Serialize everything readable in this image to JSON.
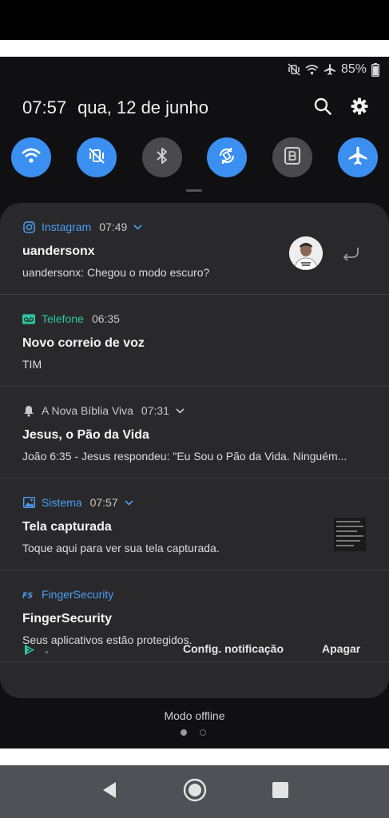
{
  "status_bar": {
    "battery_text": "85%",
    "icons": [
      "mute-vibrate-icon",
      "wifi-icon",
      "airplane-icon",
      "battery-icon"
    ]
  },
  "header": {
    "time": "07:57",
    "date": "qua, 12 de junho",
    "icons": [
      "search-icon",
      "gear-icon"
    ]
  },
  "quick_settings": [
    {
      "name": "wifi",
      "state": "on"
    },
    {
      "name": "mute",
      "state": "on"
    },
    {
      "name": "bluetooth",
      "state": "off"
    },
    {
      "name": "auto-rotate",
      "state": "on"
    },
    {
      "name": "blue-light-filter",
      "state": "off"
    },
    {
      "name": "airplane-mode",
      "state": "on"
    }
  ],
  "notifications": [
    {
      "app": "Instagram",
      "time": "07:49",
      "title": "uandersonx",
      "text": "uandersonx: Chegou o modo escuro?",
      "app_color": "#4a9ff5",
      "expandable": true
    },
    {
      "app": "Telefone",
      "time": "06:35",
      "title": "Novo correio de voz",
      "text": "TIM",
      "app_color": "#2ec4a5",
      "expandable": false
    },
    {
      "app": "A Nova Bíblia Viva",
      "time": "07:31",
      "title": "Jesus, o Pão da Vida",
      "text": "João 6:35 - Jesus respondeu: \"Eu Sou o Pão da Vida. Ninguém...",
      "app_color": "#c8c8c8",
      "expandable": true
    },
    {
      "app": "Sistema",
      "time": "07:57",
      "title": "Tela capturada",
      "text": "Toque aqui para ver sua tela capturada.",
      "app_color": "#4a9ff5",
      "expandable": true
    },
    {
      "app": "FingerSecurity",
      "time": "",
      "title": "FingerSecurity",
      "text": "Seus aplicativos estão protegidos.",
      "app_color": "#4a9ff5",
      "expandable": false
    }
  ],
  "footer": {
    "config_label": "Config. notificação",
    "clear_label": "Apagar"
  },
  "carrier": "Modo offline",
  "colors": {
    "accent": "#3a8ff0",
    "panel": "#29292b",
    "background": "#101013"
  }
}
